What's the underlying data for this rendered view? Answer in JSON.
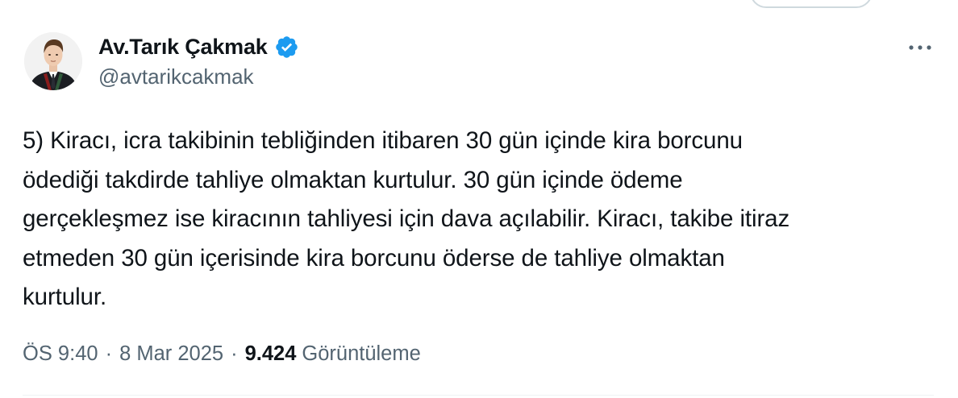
{
  "author": {
    "display_name": "Av.Tarık Çakmak",
    "handle": "@avtarikcakmak",
    "avatar_icon": "user-avatar-photo",
    "verified_icon": "verified-badge-icon",
    "verified_color": "#1d9bf0"
  },
  "tweet": {
    "text": "5) Kiracı, icra takibinin tebliğinden itibaren 30 gün içinde kira borcunu\nödediği takdirde tahliye olmaktan kurtulur. 30 gün içinde ödeme\ngerçekleşmez ise kiracının tahliyesi için dava açılabilir. Kiracı, takibe itiraz\netmeden 30 gün içerisinde kira borcunu öderse de tahliye olmaktan\nkurtulur."
  },
  "meta": {
    "time": "ÖS 9:40",
    "separator": "·",
    "date": "8 Mar 2025",
    "views_count": "9.424",
    "views_label": "Görüntüleme"
  },
  "menu": {
    "more_icon": "more-horizontal-icon"
  },
  "colors": {
    "text_primary": "#0f1419",
    "text_secondary": "#536471",
    "divider": "#eff3f4"
  }
}
